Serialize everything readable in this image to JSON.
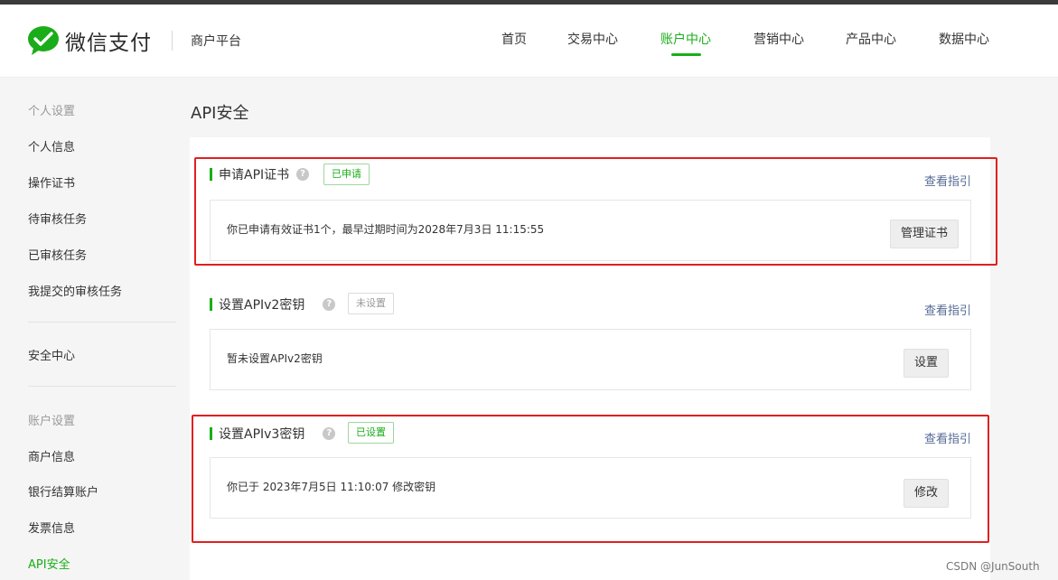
{
  "header": {
    "brand": "微信支付",
    "platform": "商户平台",
    "nav": [
      {
        "label": "首页"
      },
      {
        "label": "交易中心"
      },
      {
        "label": "账户中心"
      },
      {
        "label": "营销中心"
      },
      {
        "label": "产品中心"
      },
      {
        "label": "数据中心"
      }
    ],
    "active_nav": "账户中心"
  },
  "sidebar": {
    "group_personal": "个人设置",
    "personal_items": [
      "个人信息",
      "操作证书",
      "待审核任务",
      "已审核任务",
      "我提交的审核任务"
    ],
    "security_center": "安全中心",
    "group_account": "账户设置",
    "account_items": [
      "商户信息",
      "银行结算账户",
      "发票信息",
      "API安全"
    ],
    "active_item": "API安全"
  },
  "page": {
    "title": "API安全",
    "sections": [
      {
        "title": "申请API证书",
        "badge": "已申请",
        "guide": "查看指引",
        "text": "你已申请有效证书1个，最早过期时间为2028年7月3日 11:15:55",
        "button": "管理证书"
      },
      {
        "title": "设置APIv2密钥",
        "badge": "未设置",
        "guide": "查看指引",
        "text": "暂未设置APIv2密钥",
        "button": "设置"
      },
      {
        "title": "设置APIv3密钥",
        "badge": "已设置",
        "guide": "查看指引",
        "text": "你已于 2023年7月5日 11:10:07 修改密钥",
        "button": "修改"
      }
    ]
  },
  "help_glyph": "?",
  "watermark": "CSDN @JunSouth",
  "colors": {
    "accent": "#1aad19",
    "link": "#576b95",
    "highlight_border": "#e02020"
  }
}
